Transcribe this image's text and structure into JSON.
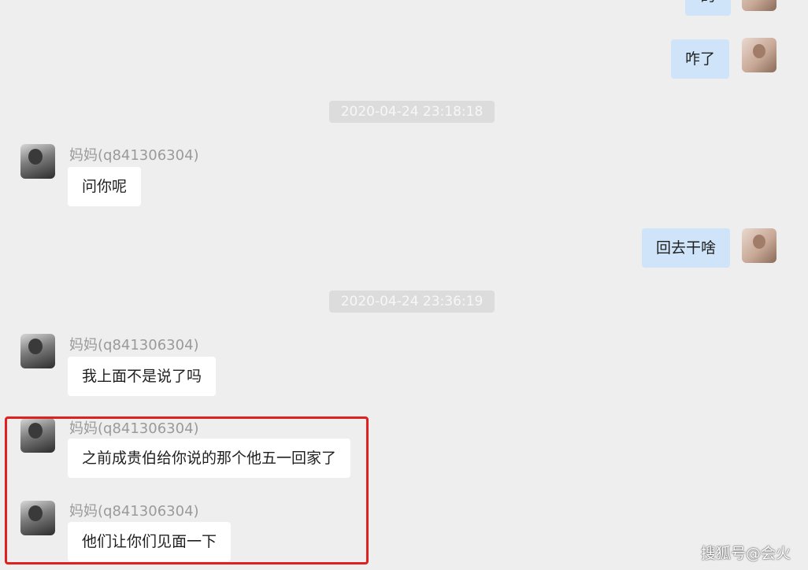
{
  "messages": {
    "out_top_partial": "的",
    "out_1": "咋了",
    "out_2": "回去干啥",
    "in_1": "问你呢",
    "in_2": "我上面不是说了吗",
    "in_3": "之前成贵伯给你说的那个他五一回家了",
    "in_4": "他们让你们见面一下"
  },
  "timestamps": {
    "t1": "2020-04-24 23:18:18",
    "t2": "2020-04-24 23:36:19"
  },
  "sender": {
    "name": "妈妈(q841306304)"
  },
  "watermark": "搜狐号@会火",
  "colors": {
    "outgoing_bubble": "#cfe4f8",
    "incoming_bubble": "#ffffff",
    "highlight": "#e02020",
    "background": "#eeeeee"
  }
}
